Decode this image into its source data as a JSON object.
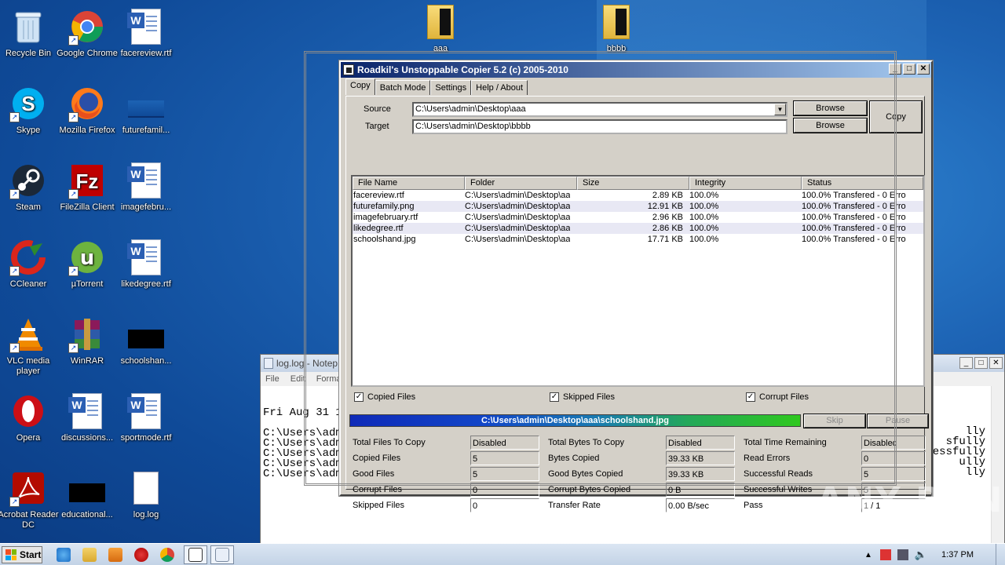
{
  "desktop": {
    "icons": [
      {
        "label": "Recycle Bin"
      },
      {
        "label": "Google Chrome"
      },
      {
        "label": "facereview.rtf"
      },
      {
        "label": "Skype"
      },
      {
        "label": "Mozilla Firefox"
      },
      {
        "label": "futurefamil..."
      },
      {
        "label": "Steam"
      },
      {
        "label": "FileZilla Client"
      },
      {
        "label": "imagefebru..."
      },
      {
        "label": "CCleaner"
      },
      {
        "label": "µTorrent"
      },
      {
        "label": "likedegree.rtf"
      },
      {
        "label": "VLC media player"
      },
      {
        "label": "WinRAR"
      },
      {
        "label": "schoolshan..."
      },
      {
        "label": "Opera"
      },
      {
        "label": "discussions..."
      },
      {
        "label": "sportmode.rtf"
      },
      {
        "label": "Acrobat Reader DC"
      },
      {
        "label": "educational..."
      },
      {
        "label": "log.log"
      }
    ],
    "folders": [
      {
        "label": "aaa"
      },
      {
        "label": "bbbb"
      }
    ]
  },
  "notepad": {
    "title": "log.log - Notep",
    "menu": [
      "File",
      "Edit",
      "Format"
    ],
    "lines_left": [
      "Fri Aug 31 1",
      "",
      "C:\\Users\\adm",
      "C:\\Users\\adm",
      "C:\\Users\\adm",
      "C:\\Users\\adm",
      "C:\\Users\\adm"
    ],
    "lines_right": [
      "lly",
      "sfully",
      "essfully",
      "ully",
      "lly"
    ]
  },
  "app": {
    "title": "Roadkil's Unstoppable Copier 5.2 (c) 2005-2010",
    "tabs": [
      "Copy",
      "Batch Mode",
      "Settings",
      "Help / About"
    ],
    "source_label": "Source",
    "target_label": "Target",
    "source_value": "C:\\Users\\admin\\Desktop\\aaa",
    "target_value": "C:\\Users\\admin\\Desktop\\bbbb",
    "browse_label": "Browse",
    "copy_label": "Copy",
    "columns": [
      "File Name",
      "Folder",
      "Size",
      "Integrity",
      "Status"
    ],
    "files": [
      {
        "name": "facereview.rtf",
        "folder": "C:\\Users\\admin\\Desktop\\aaa",
        "size": "2.89 KB",
        "integrity": "100.0%",
        "status": "100.0% Transfered - 0 Erro"
      },
      {
        "name": "futurefamily.png",
        "folder": "C:\\Users\\admin\\Desktop\\aaa",
        "size": "12.91 KB",
        "integrity": "100.0%",
        "status": "100.0% Transfered - 0 Erro"
      },
      {
        "name": "imagefebruary.rtf",
        "folder": "C:\\Users\\admin\\Desktop\\aaa",
        "size": "2.96 KB",
        "integrity": "100.0%",
        "status": "100.0% Transfered - 0 Erro"
      },
      {
        "name": "likedegree.rtf",
        "folder": "C:\\Users\\admin\\Desktop\\aaa",
        "size": "2.86 KB",
        "integrity": "100.0%",
        "status": "100.0% Transfered - 0 Erro"
      },
      {
        "name": "schoolshand.jpg",
        "folder": "C:\\Users\\admin\\Desktop\\aaa",
        "size": "17.71 KB",
        "integrity": "100.0%",
        "status": "100.0% Transfered - 0 Erro"
      }
    ],
    "checkboxes": {
      "copied": "Copied Files",
      "skipped": "Skipped Files",
      "corrupt": "Corrupt Files"
    },
    "progress_text": "C:\\Users\\admin\\Desktop\\aaa\\schoolshand.jpg",
    "skip_label": "Skip",
    "pause_label": "Pause",
    "stats": {
      "total_files_label": "Total Files To Copy",
      "total_files": "Disabled",
      "copied_files_label": "Copied Files",
      "copied_files": "5",
      "good_files_label": "Good Files",
      "good_files": "5",
      "corrupt_files_label": "Corrupt Files",
      "corrupt_files": "0",
      "skipped_files_label": "Skipped Files",
      "skipped_files": "0",
      "total_bytes_label": "Total Bytes To Copy",
      "total_bytes": "Disabled",
      "bytes_copied_label": "Bytes Copied",
      "bytes_copied": "39.33 KB",
      "good_bytes_label": "Good Bytes Copied",
      "good_bytes": "39.33 KB",
      "corrupt_bytes_label": "Corrupt Bytes Copied",
      "corrupt_bytes": "0 B",
      "transfer_rate_label": "Transfer Rate",
      "transfer_rate": "0.00 B/sec",
      "time_remaining_label": "Total Time Remaining",
      "time_remaining": "Disabled",
      "read_errors_label": "Read Errors",
      "read_errors": "0",
      "successful_reads_label": "Successful Reads",
      "successful_reads": "5",
      "successful_writes_label": "Successful Writes",
      "successful_writes": "5",
      "pass_label": "Pass",
      "pass": "1 / 1"
    }
  },
  "taskbar": {
    "start_label": "Start",
    "clock": "1:37 PM"
  },
  "watermark": "ANY RUN",
  "colors": {
    "desktop": "#1d63b4",
    "title_bar": "#0a246a",
    "window_face": "#d4d0c8"
  }
}
